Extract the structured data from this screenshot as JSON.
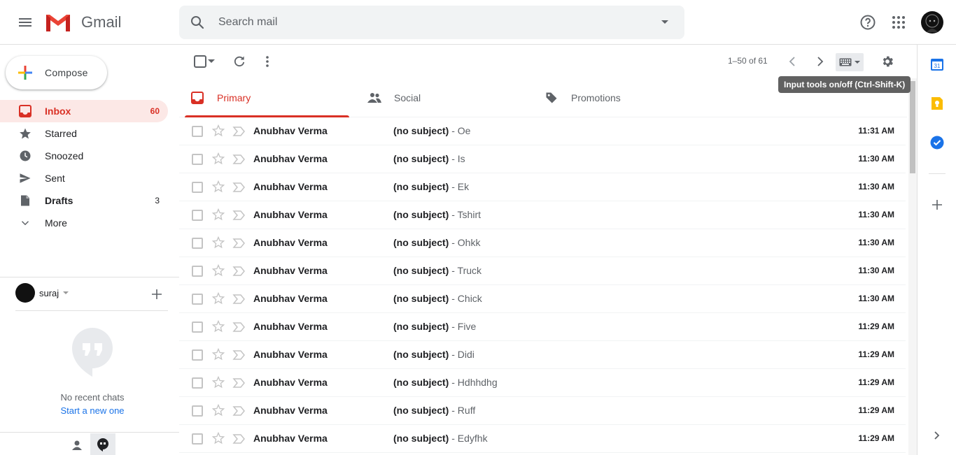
{
  "header": {
    "app_name": "Gmail",
    "search_placeholder": "Search mail",
    "colors": {
      "gmail_red": "#ea4335",
      "icon_gray": "#5f6368"
    }
  },
  "nav": {
    "compose_label": "Compose",
    "items": [
      {
        "label": "Inbox",
        "count": "60",
        "icon": "inbox-icon",
        "active": true
      },
      {
        "label": "Starred",
        "count": "",
        "icon": "star-icon"
      },
      {
        "label": "Snoozed",
        "count": "",
        "icon": "clock-icon"
      },
      {
        "label": "Sent",
        "count": "",
        "icon": "send-icon"
      },
      {
        "label": "Drafts",
        "count": "3",
        "icon": "draft-icon"
      },
      {
        "label": "More",
        "count": "",
        "icon": "chevron-down-icon"
      }
    ]
  },
  "hangouts": {
    "user_name": "suraj",
    "no_chats": "No recent chats",
    "start_new": "Start a new one"
  },
  "toolbar": {
    "pagination": "1–50 of 61",
    "tooltip": "Input tools on/off (Ctrl-Shift-K)"
  },
  "tabs": [
    {
      "label": "Primary",
      "icon": "inbox-icon",
      "active": true
    },
    {
      "label": "Social",
      "icon": "people-icon"
    },
    {
      "label": "Promotions",
      "icon": "tag-icon"
    }
  ],
  "messages": [
    {
      "sender": "Anubhav Verma",
      "subject": "(no subject)",
      "snippet": "Oe",
      "time": "11:31 AM"
    },
    {
      "sender": "Anubhav Verma",
      "subject": "(no subject)",
      "snippet": "Is",
      "time": "11:30 AM"
    },
    {
      "sender": "Anubhav Verma",
      "subject": "(no subject)",
      "snippet": "Ek",
      "time": "11:30 AM"
    },
    {
      "sender": "Anubhav Verma",
      "subject": "(no subject)",
      "snippet": "Tshirt",
      "time": "11:30 AM"
    },
    {
      "sender": "Anubhav Verma",
      "subject": "(no subject)",
      "snippet": "Ohkk",
      "time": "11:30 AM"
    },
    {
      "sender": "Anubhav Verma",
      "subject": "(no subject)",
      "snippet": "Truck",
      "time": "11:30 AM"
    },
    {
      "sender": "Anubhav Verma",
      "subject": "(no subject)",
      "snippet": "Chick",
      "time": "11:30 AM"
    },
    {
      "sender": "Anubhav Verma",
      "subject": "(no subject)",
      "snippet": "Five",
      "time": "11:29 AM"
    },
    {
      "sender": "Anubhav Verma",
      "subject": "(no subject)",
      "snippet": "Didi",
      "time": "11:29 AM"
    },
    {
      "sender": "Anubhav Verma",
      "subject": "(no subject)",
      "snippet": "Hdhhdhg",
      "time": "11:29 AM"
    },
    {
      "sender": "Anubhav Verma",
      "subject": "(no subject)",
      "snippet": "Ruff",
      "time": "11:29 AM"
    },
    {
      "sender": "Anubhav Verma",
      "subject": "(no subject)",
      "snippet": "Edyfhk",
      "time": "11:29 AM"
    }
  ],
  "side_panel": {
    "items": [
      "calendar-icon",
      "keep-icon",
      "tasks-icon",
      "add-icon",
      "expand-icon"
    ],
    "colors": {
      "calendar": "#1a73e8",
      "keep": "#fbbc04",
      "tasks": "#1a73e8"
    },
    "calendar_day": "31"
  }
}
